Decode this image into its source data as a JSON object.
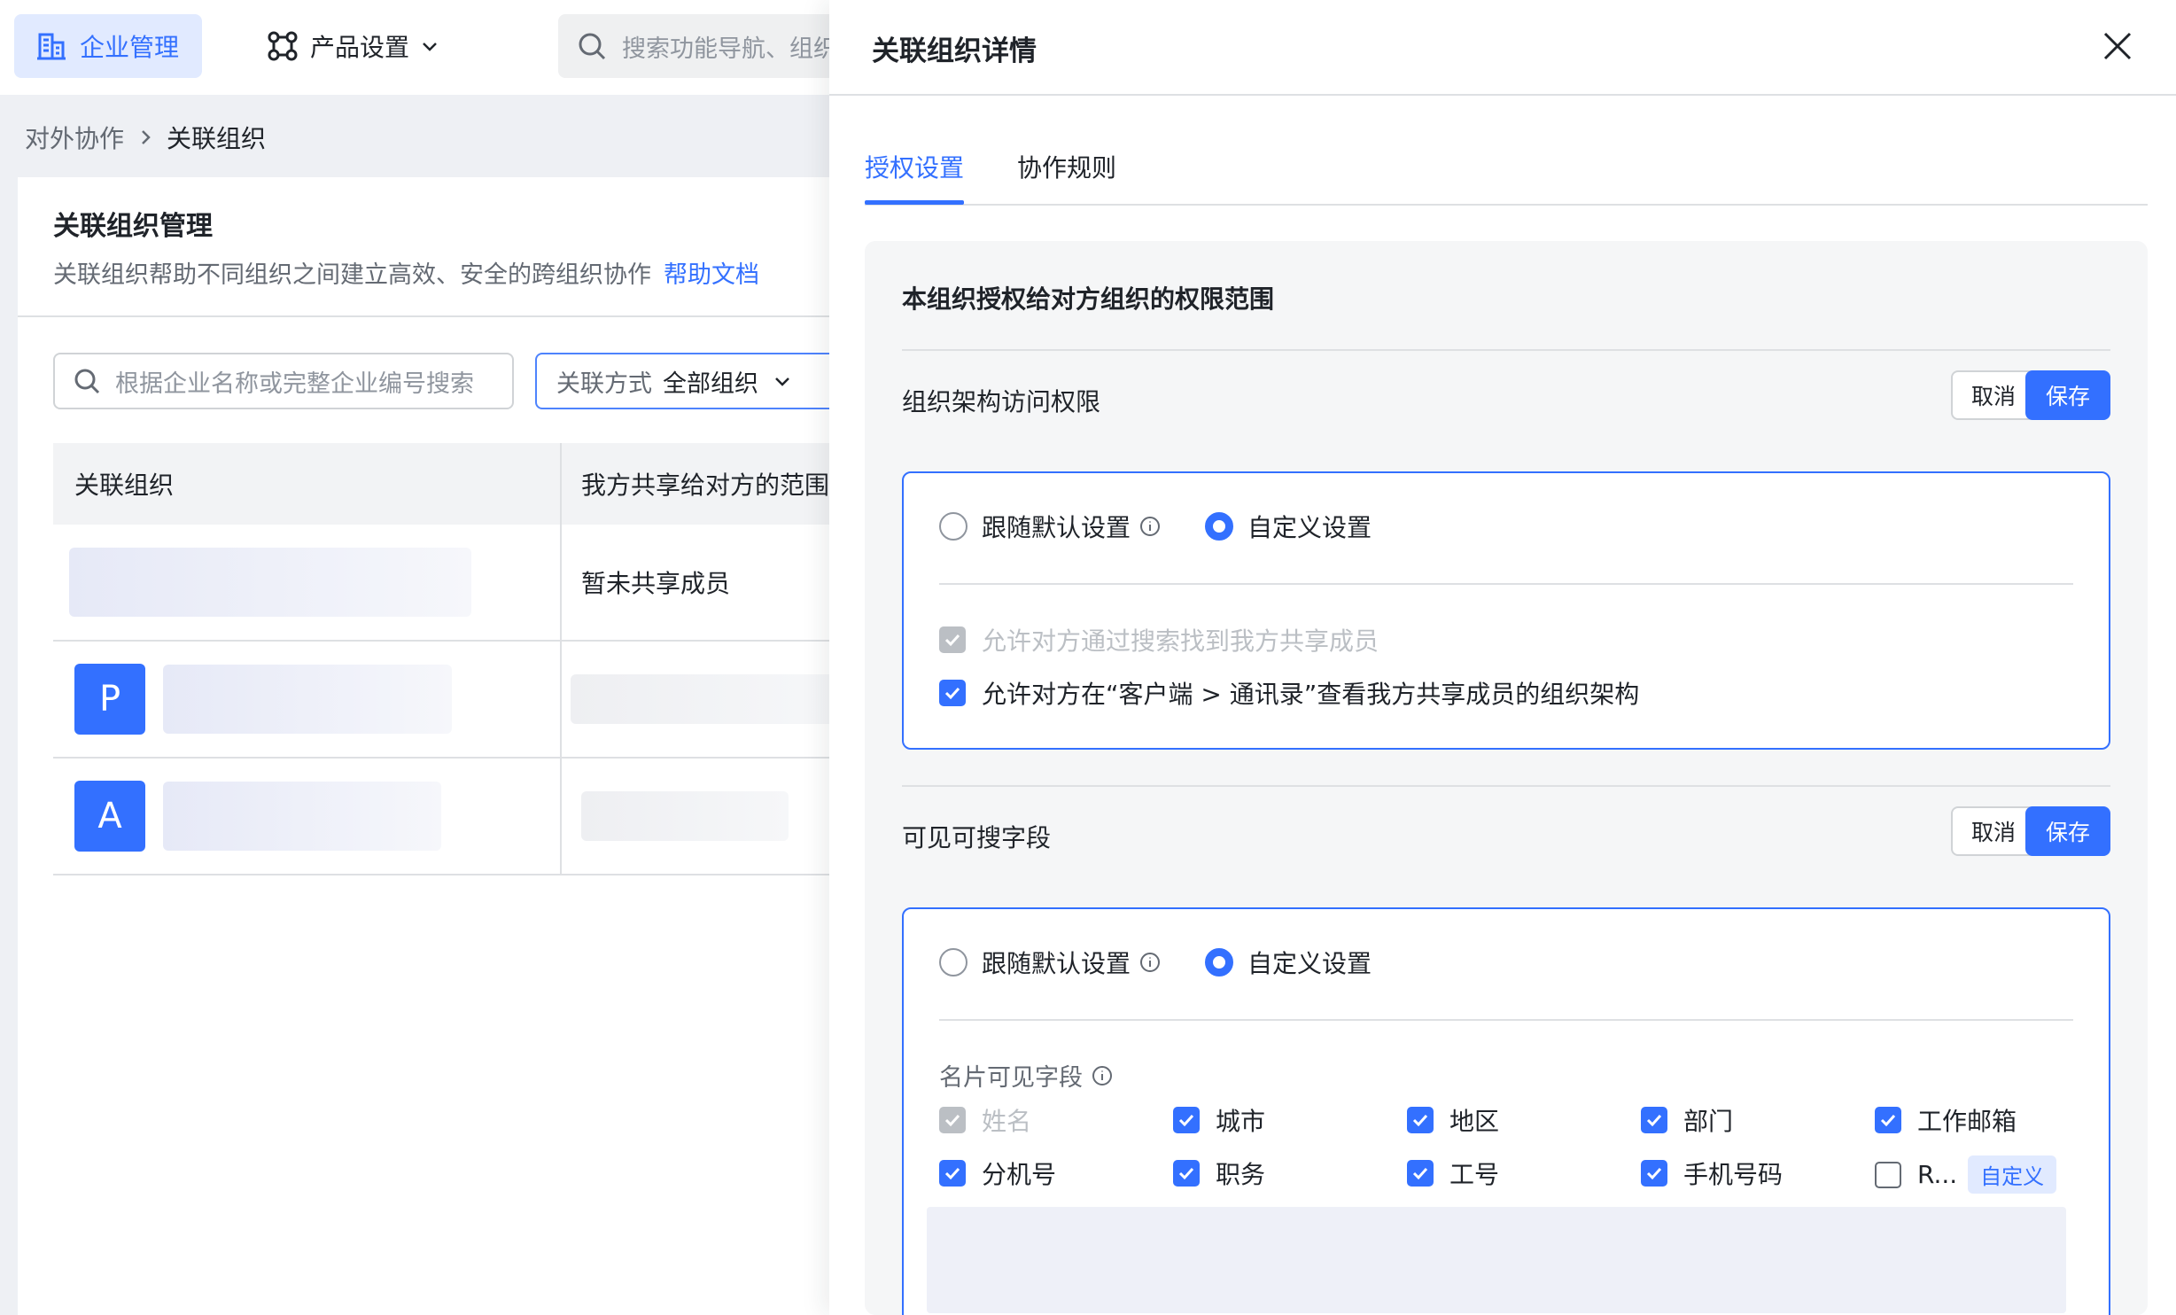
{
  "topbar": {
    "nav_enterprise": "企业管理",
    "nav_product": "产品设置",
    "search_placeholder": "搜索功能导航、组织架构"
  },
  "breadcrumb": {
    "parent": "对外协作",
    "current": "关联组织"
  },
  "card": {
    "title": "关联组织管理",
    "description": "关联组织帮助不同组织之间建立高效、安全的跨组织协作",
    "help_link": "帮助文档"
  },
  "filters": {
    "search_placeholder": "根据企业名称或完整企业编号搜索",
    "relation_label": "关联方式",
    "relation_value": "全部组织"
  },
  "table": {
    "columns": [
      "关联组织",
      "我方共享给对方的范围"
    ],
    "rows": [
      {
        "avatar": "",
        "share_scope": "暂未共享成员"
      },
      {
        "avatar": "P",
        "share_scope": ""
      },
      {
        "avatar": "A",
        "share_scope": ""
      }
    ]
  },
  "drawer": {
    "title": "关联组织详情",
    "tabs": [
      {
        "label": "授权设置",
        "active": true
      },
      {
        "label": "协作规则",
        "active": false
      }
    ],
    "panel_title": "本组织授权给对方组织的权限范围",
    "sections": [
      {
        "title": "组织架构访问权限",
        "cancel": "取消",
        "save": "保存",
        "radio_default": "跟随默认设置",
        "radio_custom": "自定义设置",
        "checks": [
          {
            "label": "允许对方通过搜索找到我方共享成员",
            "checked": true,
            "disabled": true
          },
          {
            "label": "允许对方在“客户端 > 通讯录”查看我方共享成员的组织架构",
            "checked": true,
            "disabled": false
          }
        ]
      },
      {
        "title": "可见可搜字段",
        "cancel": "取消",
        "save": "保存",
        "radio_default": "跟随默认设置",
        "radio_custom": "自定义设置",
        "fields_label": "名片可见字段",
        "fields": [
          {
            "label": "姓名",
            "checked": true,
            "disabled": true
          },
          {
            "label": "城市",
            "checked": true
          },
          {
            "label": "地区",
            "checked": true
          },
          {
            "label": "部门",
            "checked": true
          },
          {
            "label": "工作邮箱",
            "checked": true
          },
          {
            "label": "分机号",
            "checked": true
          },
          {
            "label": "职务",
            "checked": true
          },
          {
            "label": "工号",
            "checked": true
          },
          {
            "label": "手机号码",
            "checked": true
          },
          {
            "label": "R...",
            "checked": false,
            "tag": "自定义"
          }
        ]
      }
    ]
  },
  "colors": {
    "primary": "#3370ff",
    "primary_light": "#e1eaff",
    "text": "#1f2329",
    "muted": "#646a73",
    "disabled": "#bbbfc4"
  }
}
